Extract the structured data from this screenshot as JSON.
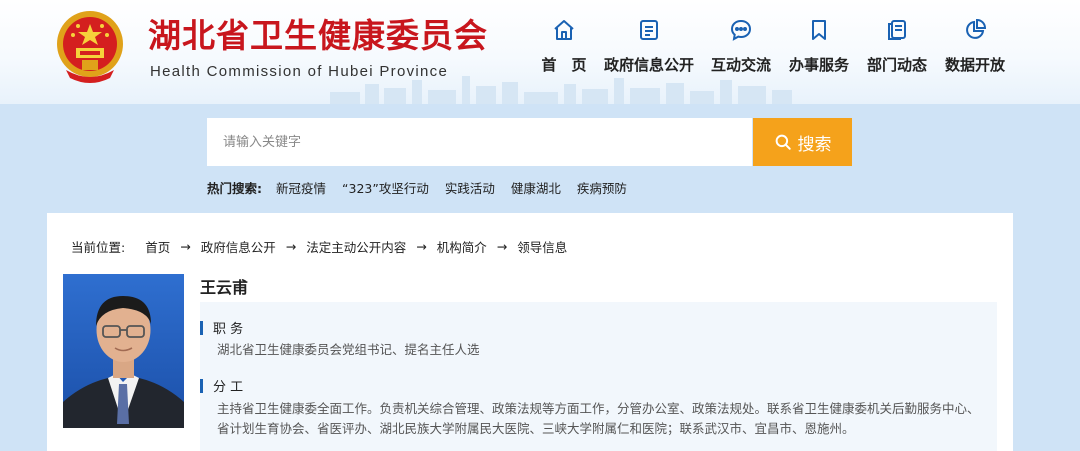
{
  "header": {
    "title": "湖北省卫生健康委员会",
    "subtitle": "Health Commission of Hubei Province"
  },
  "nav": [
    {
      "label": "首　页",
      "icon": "home-icon"
    },
    {
      "label": "政府信息公开",
      "icon": "document-icon"
    },
    {
      "label": "互动交流",
      "icon": "chat-icon"
    },
    {
      "label": "办事服务",
      "icon": "bookmark-icon"
    },
    {
      "label": "部门动态",
      "icon": "news-icon"
    },
    {
      "label": "数据开放",
      "icon": "pie-chart-icon"
    }
  ],
  "search": {
    "placeholder": "请输入关键字",
    "button_label": "搜索"
  },
  "hot": {
    "label": "热门搜索:",
    "links": [
      "新冠疫情",
      "“323”攻坚行动",
      "实践活动",
      "健康湖北",
      "疾病预防"
    ]
  },
  "breadcrumb": {
    "prefix": "当前位置:",
    "items": [
      "首页",
      "政府信息公开",
      "法定主动公开内容",
      "机构简介",
      "领导信息"
    ],
    "separator": "→"
  },
  "profile": {
    "name": "王云甫",
    "sections": [
      {
        "heading": "职 务",
        "text": "湖北省卫生健康委员会党组书记、提名主任人选"
      },
      {
        "heading": "分 工",
        "text": "主持省卫生健康委全面工作。负责机关综合管理、政策法规等方面工作，分管办公室、政策法规处。联系省卫生健康委机关后勤服务中心、省计划生育协会、省医评办、湖北民族大学附属民大医院、三峡大学附属仁和医院；联系武汉市、宜昌市、恩施州。"
      }
    ]
  },
  "colors": {
    "title_red": "#c8161d",
    "accent_blue": "#1a62b3",
    "search_orange": "#f5a21b"
  }
}
